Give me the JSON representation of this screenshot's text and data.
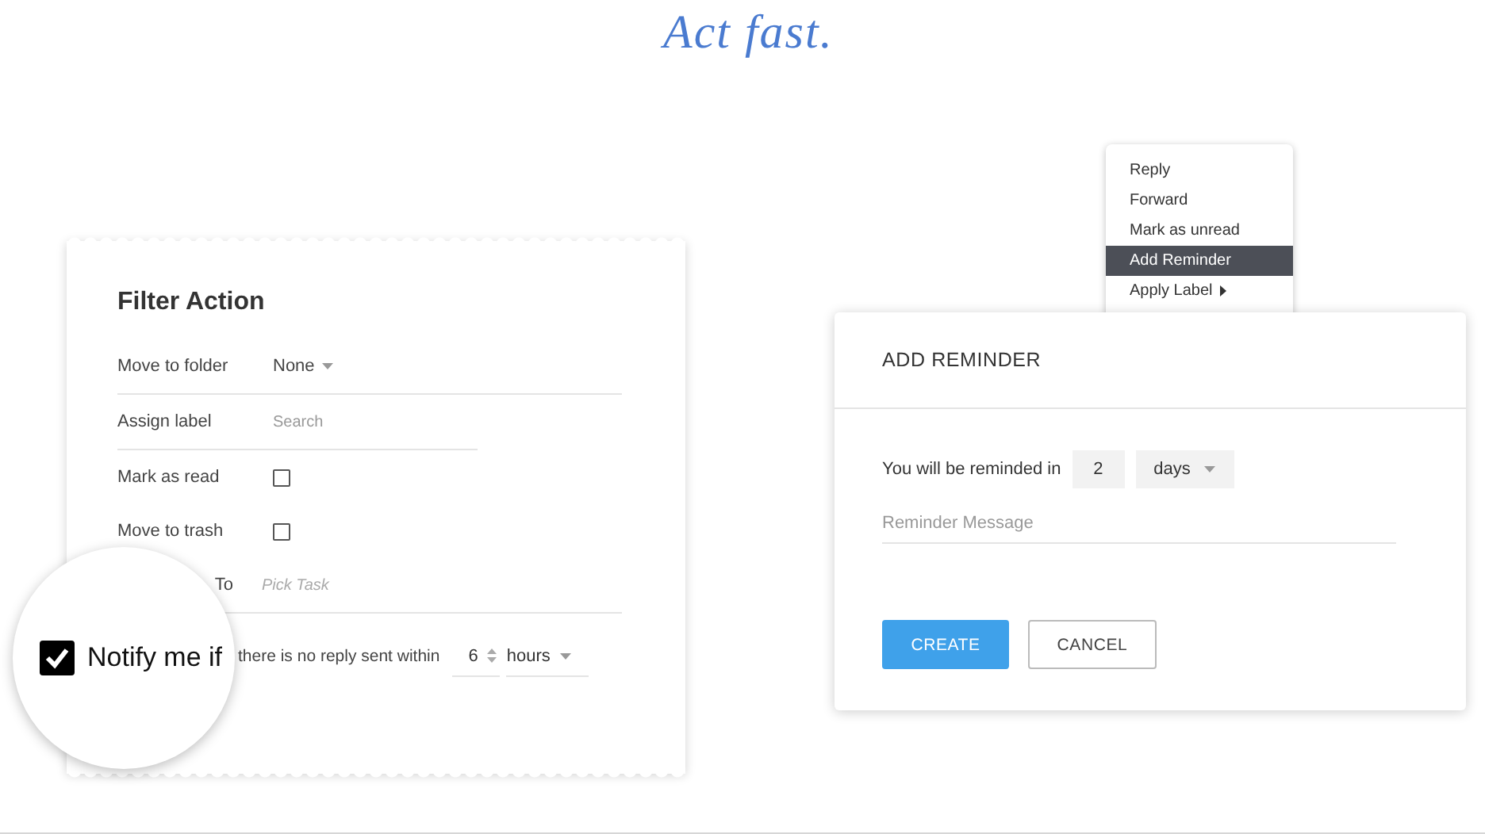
{
  "headline": "Act fast.",
  "filter_action": {
    "title": "Filter Action",
    "rows": [
      {
        "kind": "select",
        "label": "Move to folder",
        "value": "None"
      },
      {
        "kind": "search",
        "label": "Assign label",
        "placeholder": "Search"
      },
      {
        "kind": "checkbox",
        "label": "Mark as read",
        "checked": false
      },
      {
        "kind": "checkbox",
        "label": "Move to trash",
        "checked": false
      },
      {
        "kind": "task",
        "label": "To",
        "placeholder": "Pick Task"
      },
      {
        "kind": "notify",
        "text": "there is no reply sent within",
        "number": "6",
        "unit": "hours"
      }
    ]
  },
  "magnifier": {
    "checked": true,
    "label": "Notify me if"
  },
  "context_menu": {
    "items": [
      {
        "label": "Reply",
        "selected": false,
        "submenu": false
      },
      {
        "label": "Forward",
        "selected": false,
        "submenu": false
      },
      {
        "label": "Mark as unread",
        "selected": false,
        "submenu": false
      },
      {
        "label": "Add Reminder",
        "selected": true,
        "submenu": false
      },
      {
        "label": "Apply Label",
        "selected": false,
        "submenu": true
      }
    ]
  },
  "reminder_dialog": {
    "title": "ADD REMINDER",
    "prompt": "You will be reminded in",
    "amount": "2",
    "unit": "days",
    "placeholder": "Reminder Message",
    "buttons": [
      {
        "label": "CREATE",
        "kind": "primary"
      },
      {
        "label": "CANCEL",
        "kind": "secondary"
      }
    ]
  }
}
